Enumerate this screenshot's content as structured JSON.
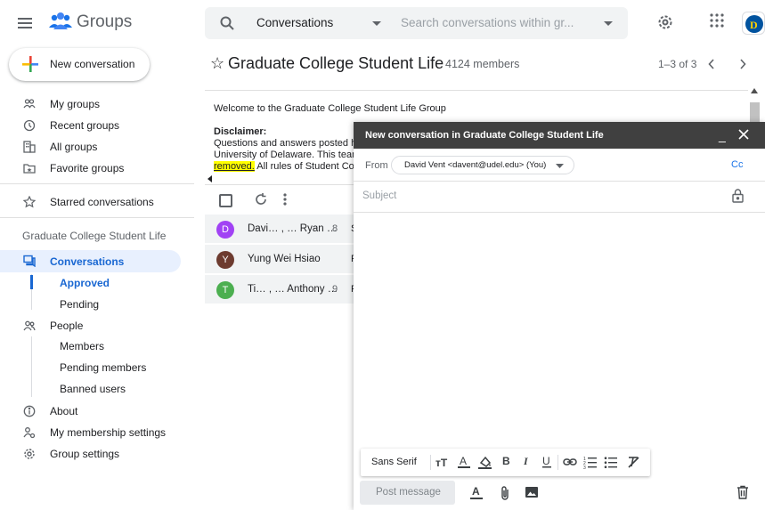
{
  "header": {
    "app_title": "Groups",
    "search_scope": "Conversations",
    "search_placeholder": "Search conversations within gr..."
  },
  "sidebar": {
    "new_conversation": "New conversation",
    "items": [
      {
        "label": "My groups",
        "icon": "people-outline-icon"
      },
      {
        "label": "Recent groups",
        "icon": "clock-icon"
      },
      {
        "label": "All groups",
        "icon": "building-icon"
      },
      {
        "label": "Favorite groups",
        "icon": "folder-star-icon"
      }
    ],
    "starred": "Starred conversations",
    "group_name": "Graduate College Student Life",
    "conversations": "Conversations",
    "conv_sub": [
      "Approved",
      "Pending"
    ],
    "people": "People",
    "people_sub": [
      "Members",
      "Pending members",
      "Banned users"
    ],
    "about": "About",
    "membership_settings": "My membership settings",
    "group_settings": "Group settings"
  },
  "main": {
    "star": "☆",
    "group_title": "Graduate College Student Life",
    "members": "4124 members",
    "pager": "1–3 of 3",
    "welcome": "Welcome to the Graduate College Student Life Group",
    "disclaimer_heading": "Disclaimer:",
    "disclaimer_l1": "Questions and answers posted he",
    "disclaimer_l2": "University of Delaware. This team",
    "disclaimer_l3_hl": "removed.",
    "disclaimer_l3": " All rules of Student Cor",
    "threads": [
      {
        "initial": "D",
        "color": "#a142f4",
        "names": "Davi… , … Ryan …",
        "count": "8",
        "subject": "S"
      },
      {
        "initial": "Y",
        "color": "#6d3b2f",
        "names": "Yung Wei Hsiao",
        "count": "",
        "subject": "F"
      },
      {
        "initial": "T",
        "color": "#4caf50",
        "names": "Ti… , … Anthony …",
        "count": "9",
        "subject": "F"
      }
    ]
  },
  "compose": {
    "title": "New conversation in Graduate College Student Life",
    "minimize": "_",
    "from_label": "From",
    "from_value": "David Vent <davent@udel.edu> (You)",
    "cc": "Cc",
    "subject_placeholder": "Subject",
    "font_name": "Sans Serif",
    "post_button": "Post message"
  },
  "colors": {
    "accent": "#1967d2",
    "active_bg": "#e8f0fe",
    "compose_header": "#404040",
    "highlight": "#ffff00"
  }
}
